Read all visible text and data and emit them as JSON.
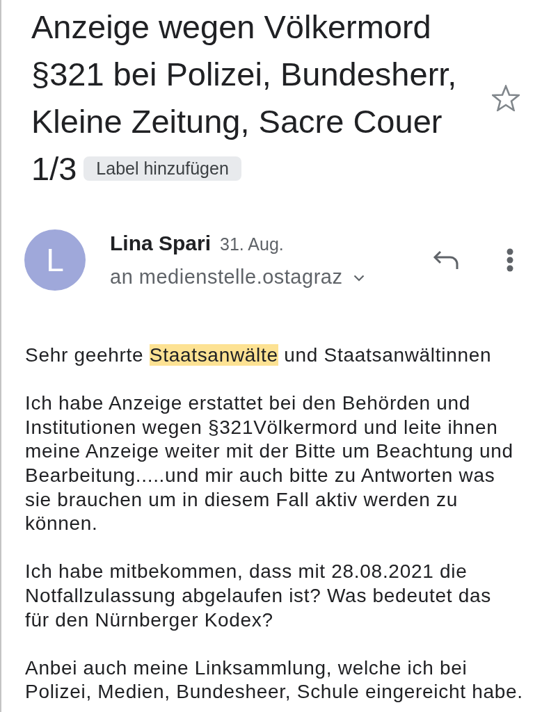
{
  "message": {
    "subject": "Anzeige wegen Völkermord §321 bei Polizei, Bundesherr, Kleine Zeitung, Sacre Couer 1/3",
    "label_chip": "Label hinzufügen",
    "starred": false
  },
  "sender": {
    "avatar_letter": "L",
    "name": "Lina Spari",
    "date": "31. Aug.",
    "recipients": "an medienstelle.ostagraz"
  },
  "body": [
    {
      "segments": [
        {
          "text": "Sehr geehrte ",
          "highlighted": false
        },
        {
          "text": "Staatsanwälte",
          "highlighted": true
        },
        {
          "text": " und Staatsanwältinnen",
          "highlighted": false
        }
      ]
    },
    {
      "segments": [
        {
          "text": "Ich habe Anzeige erstattet bei den Behörden und Institutionen wegen §321Völkermord und leite ihnen meine Anzeige weiter mit der Bitte um Beachtung und Bearbeitung.....und mir auch bitte zu Antworten was sie brauchen um in diesem Fall aktiv werden zu können.",
          "highlighted": false
        }
      ]
    },
    {
      "segments": [
        {
          "text": "Ich habe mitbekommen, dass mit 28.08.2021 die Notfallzulassung abgelaufen ist? Was bedeutet das für den Nürnberger Kodex?",
          "highlighted": false
        }
      ]
    },
    {
      "segments": [
        {
          "text": "Anbei auch meine Linksammlung, welche ich bei Polizei, Medien, Bundesheer, Schule eingereicht habe.",
          "highlighted": false
        }
      ]
    }
  ]
}
